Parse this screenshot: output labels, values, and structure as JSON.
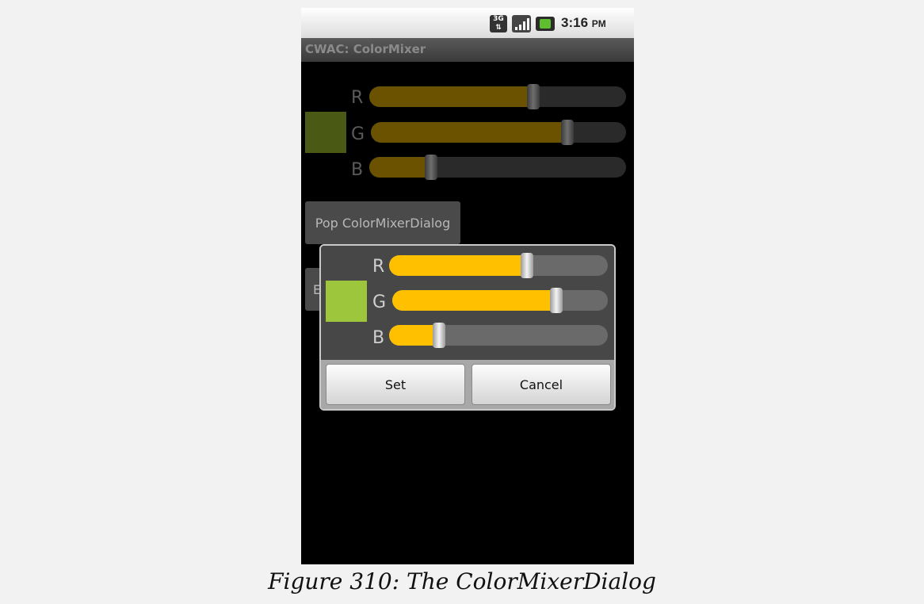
{
  "status_bar": {
    "network_icon": "3g-icon",
    "signal_icon": "signal-icon",
    "battery_icon": "battery-charging-icon",
    "time": "3:16",
    "ampm": "PM"
  },
  "app": {
    "title": "CWAC: ColorMixer"
  },
  "background_mixer": {
    "swatch_color": "#4a5a14",
    "channels": [
      {
        "label": "R",
        "value_fraction": 0.64
      },
      {
        "label": "G",
        "value_fraction": 0.77
      },
      {
        "label": "B",
        "value_fraction": 0.24
      }
    ],
    "pop_button_label": "Pop ColorMixerDialog",
    "second_button_label": "E"
  },
  "dialog": {
    "swatch_color": "#9dc63c",
    "channels": [
      {
        "label": "R",
        "value_fraction": 0.63
      },
      {
        "label": "G",
        "value_fraction": 0.76
      },
      {
        "label": "B",
        "value_fraction": 0.23
      }
    ],
    "set_label": "Set",
    "cancel_label": "Cancel"
  },
  "colors": {
    "slider_fill": "#ffc000",
    "slider_fill_dim": "#6a5200",
    "track": "#6a6a6a",
    "track_dim": "#2a2a2a"
  },
  "caption": "Figure 310: The ColorMixerDialog"
}
